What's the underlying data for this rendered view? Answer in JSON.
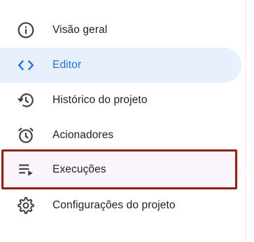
{
  "nav": {
    "items": [
      {
        "label": "Visão geral",
        "icon": "info-icon",
        "state": "normal"
      },
      {
        "label": "Editor",
        "icon": "code-icon",
        "state": "active"
      },
      {
        "label": "Histórico do projeto",
        "icon": "history-icon",
        "state": "normal"
      },
      {
        "label": "Acionadores",
        "icon": "alarm-clock-icon",
        "state": "normal"
      },
      {
        "label": "Execuções",
        "icon": "executions-list-icon",
        "state": "highlighted"
      },
      {
        "label": "Configurações do projeto",
        "icon": "gear-icon",
        "state": "normal"
      }
    ]
  },
  "colors": {
    "active_bg": "#e8f0fe",
    "active_text": "#1a73e8",
    "icon": "#5f6368",
    "text": "#202124",
    "highlight_border": "#8b2316"
  }
}
